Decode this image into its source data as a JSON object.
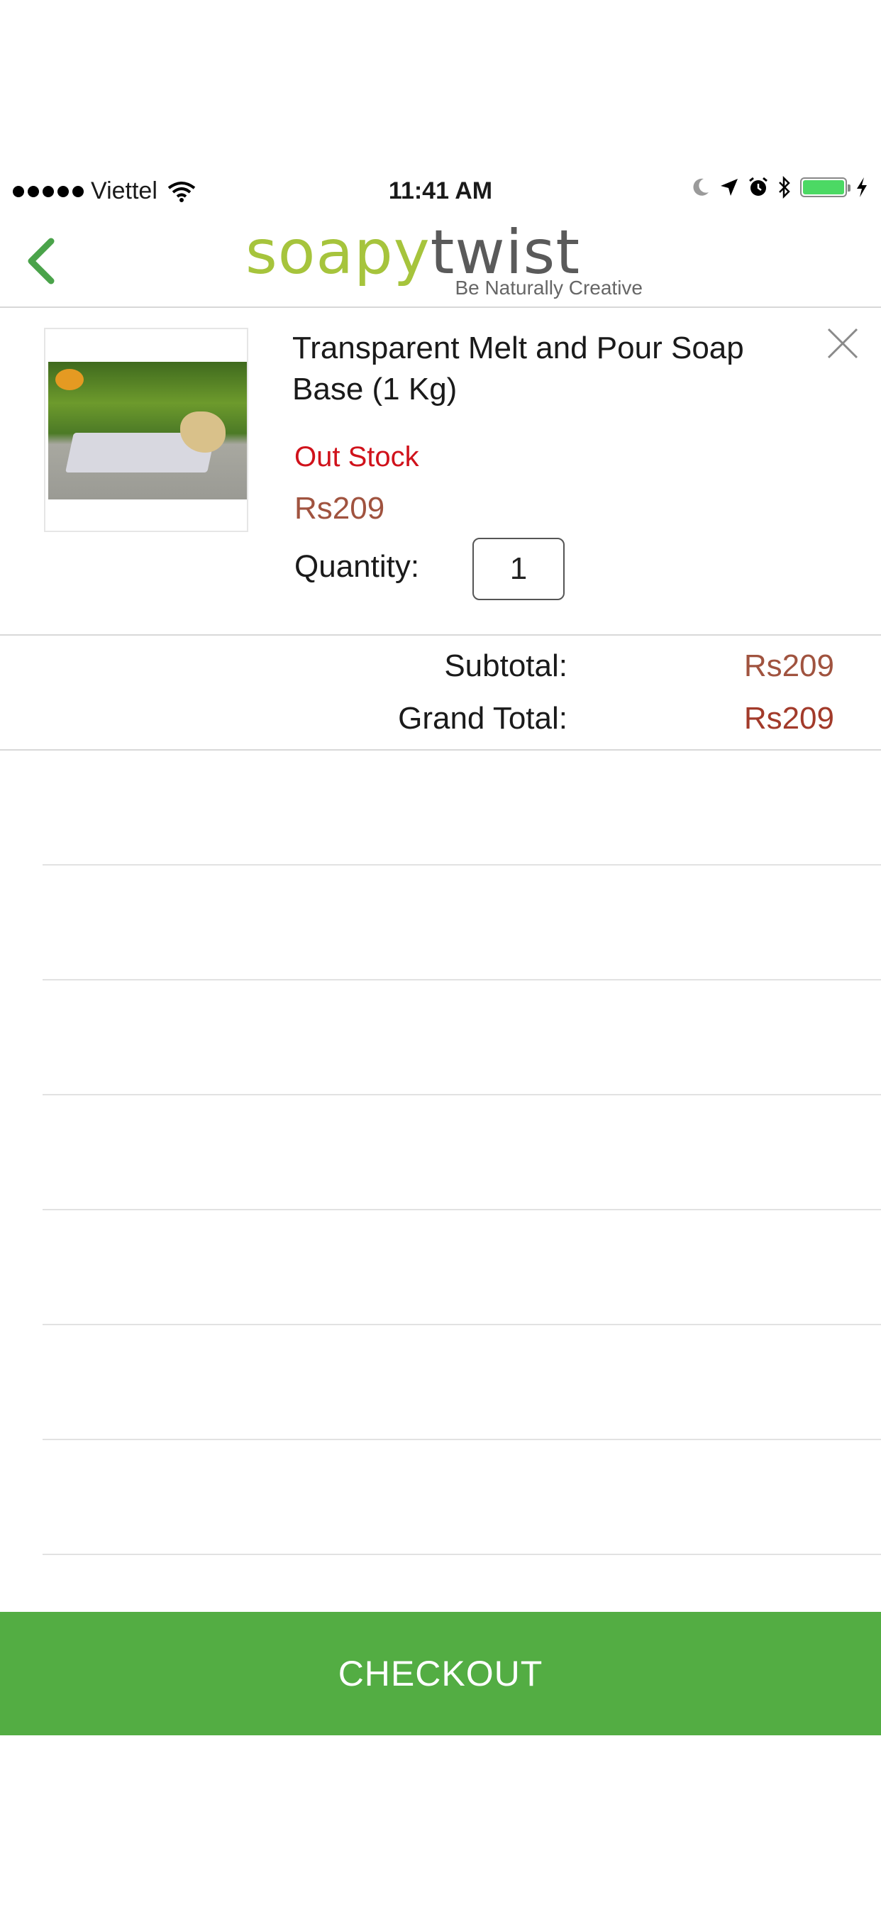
{
  "status_bar": {
    "carrier": "Viettel",
    "time": "11:41 AM",
    "icons": [
      "signal-dots-icon",
      "wifi-icon",
      "moon-icon",
      "location-arrow-icon",
      "alarm-icon",
      "bluetooth-icon",
      "battery-icon",
      "charging-bolt-icon"
    ]
  },
  "header": {
    "logo_part1": "soapy",
    "logo_part2": "twist",
    "logo_tagline": "Be Naturally Creative",
    "brand_green": "#a6c43c",
    "back_color": "#4aa34a"
  },
  "cart_item": {
    "title": "Transparent Melt and Pour Soap Base (1 Kg)",
    "stock_status": "Out Stock",
    "price": "Rs209",
    "quantity_label": "Quantity:",
    "quantity_value": "1"
  },
  "totals": {
    "subtotal_label": "Subtotal:",
    "subtotal_value": "Rs209",
    "grand_total_label": "Grand Total:",
    "grand_total_value": "Rs209"
  },
  "checkout": {
    "label": "CHECKOUT",
    "color": "#53ad43"
  }
}
